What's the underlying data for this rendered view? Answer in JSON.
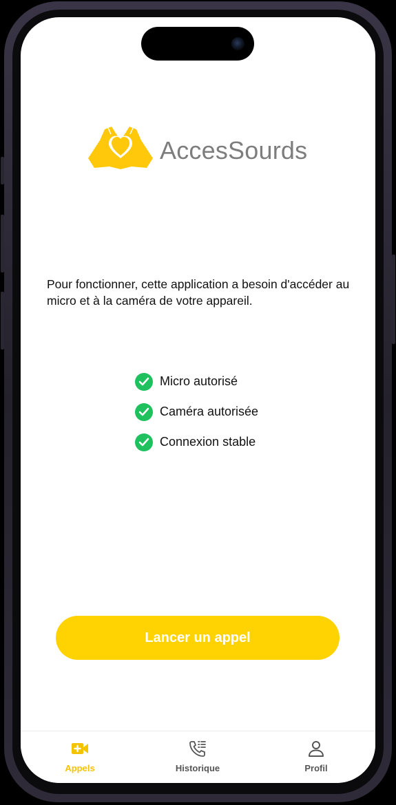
{
  "app": {
    "brand_name": "AccesSourds",
    "logo_icon": "heart-hands-icon"
  },
  "permission": {
    "message": "Pour fonctionner, cette application a besoin d'accéder au micro et à la caméra de votre appareil."
  },
  "checks": [
    {
      "label": "Micro autorisé",
      "status": "ok",
      "icon": "check-circle-icon"
    },
    {
      "label": "Caméra autorisée",
      "status": "ok",
      "icon": "check-circle-icon"
    },
    {
      "label": "Connexion stable",
      "status": "ok",
      "icon": "check-circle-icon"
    }
  ],
  "call_button": {
    "label": "Lancer un appel"
  },
  "tabbar": {
    "tabs": [
      {
        "label": "Appels",
        "icon": "video-call-icon",
        "active": true
      },
      {
        "label": "Historique",
        "icon": "call-history-icon",
        "active": false
      },
      {
        "label": "Profil",
        "icon": "user-icon",
        "active": false
      }
    ]
  },
  "colors": {
    "accent": "#ffd202",
    "success": "#1ec15e",
    "brand_text": "#7d7d7d",
    "tab_inactive": "#555555",
    "tab_active": "#f5c400"
  }
}
